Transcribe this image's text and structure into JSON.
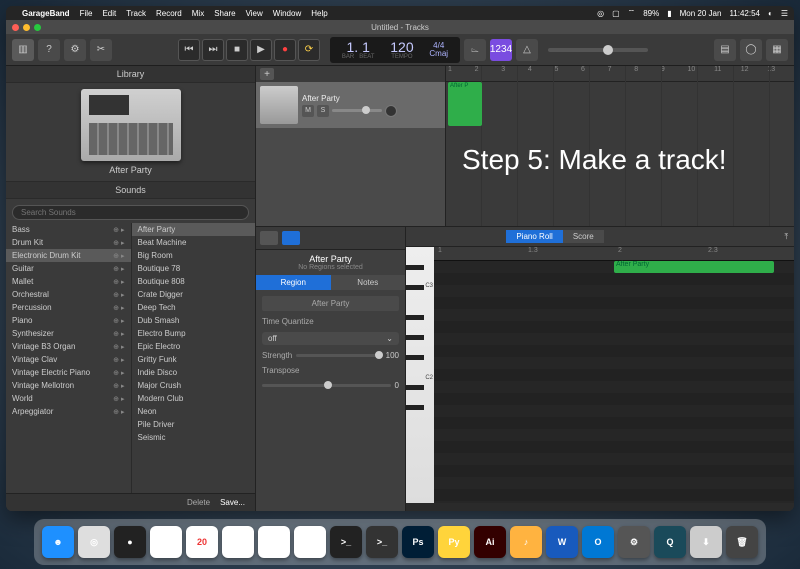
{
  "menubar": {
    "app": "GarageBand",
    "items": [
      "File",
      "Edit",
      "Track",
      "Record",
      "Mix",
      "Share",
      "View",
      "Window",
      "Help"
    ],
    "battery": "89%",
    "date": "Mon 20 Jan",
    "time": "11:42:54"
  },
  "window": {
    "title": "Untitled - Tracks"
  },
  "toolbar": {
    "lcd": {
      "bar_beat": "1. 1",
      "tempo": "120",
      "sig": "4/4",
      "key": "Cmaj",
      "bar_label": "BAR",
      "beat_label": "BEAT",
      "tempo_label": "TEMPO"
    },
    "countin_badge": "1234"
  },
  "library": {
    "header": "Library",
    "device_name": "After Party",
    "sounds_header": "Sounds",
    "search_placeholder": "Search Sounds",
    "categories": [
      "Bass",
      "Drum Kit",
      "Electronic Drum Kit",
      "Guitar",
      "Mallet",
      "Orchestral",
      "Percussion",
      "Piano",
      "Synthesizer",
      "Vintage B3 Organ",
      "Vintage Clav",
      "Vintage Electric Piano",
      "Vintage Mellotron",
      "World",
      "Arpeggiator"
    ],
    "selected_category_index": 2,
    "presets": [
      "After Party",
      "Beat Machine",
      "Big Room",
      "Boutique 78",
      "Boutique 808",
      "Crate Digger",
      "Deep Tech",
      "Dub Smash",
      "Electro Bump",
      "Epic Electro",
      "Gritty Funk",
      "Indie Disco",
      "Major Crush",
      "Modern Club",
      "Neon",
      "Pile Driver",
      "Seismic"
    ],
    "selected_preset_index": 0,
    "delete": "Delete",
    "save": "Save..."
  },
  "tracks": {
    "ruler": [
      "1",
      "2",
      "3",
      "4",
      "5",
      "6",
      "7",
      "8",
      "9",
      "10",
      "11",
      "12",
      "13"
    ],
    "track_name": "After Party",
    "region_name": "After P"
  },
  "overlay": "Step 5: Make a track!",
  "editor": {
    "view_tabs": [
      "Piano Roll",
      "Score"
    ],
    "title": "After Party",
    "subtitle": "No Regions selected",
    "tabs": [
      "Region",
      "Notes"
    ],
    "region_name": "After Party",
    "quantize_label": "Time Quantize",
    "quantize_value": "off",
    "strength_label": "Strength",
    "strength_value": "100",
    "transpose_label": "Transpose",
    "transpose_value": "0",
    "ruler": [
      "1",
      "1.3",
      "2",
      "2.3"
    ],
    "region2_name": "After Party",
    "clabels": [
      "C3",
      "C2"
    ]
  },
  "dock": {
    "items": [
      {
        "name": "finder",
        "bg": "#1e90ff",
        "label": "☻"
      },
      {
        "name": "safari",
        "bg": "#dedede",
        "label": "◎"
      },
      {
        "name": "siri",
        "bg": "#222",
        "label": "●"
      },
      {
        "name": "mail",
        "bg": "#fff",
        "label": "✉"
      },
      {
        "name": "calendar",
        "bg": "#fff",
        "label": "20"
      },
      {
        "name": "chrome",
        "bg": "#fff",
        "label": "◉"
      },
      {
        "name": "apps",
        "bg": "#fff",
        "label": "⊞"
      },
      {
        "name": "photos",
        "bg": "#fff",
        "label": "✿"
      },
      {
        "name": "terminal",
        "bg": "#222",
        "label": ">_"
      },
      {
        "name": "terminal2",
        "bg": "#333",
        "label": ">_"
      },
      {
        "name": "photoshop",
        "bg": "#001e36",
        "label": "Ps"
      },
      {
        "name": "python",
        "bg": "#ffd43b",
        "label": "Py"
      },
      {
        "name": "illustrator",
        "bg": "#330000",
        "label": "Ai"
      },
      {
        "name": "garageband",
        "bg": "#ffb340",
        "label": "♪"
      },
      {
        "name": "word",
        "bg": "#185abd",
        "label": "W"
      },
      {
        "name": "outlook",
        "bg": "#0078d4",
        "label": "O"
      },
      {
        "name": "settings",
        "bg": "#555",
        "label": "⚙"
      },
      {
        "name": "quicktime",
        "bg": "#1a4a5a",
        "label": "Q"
      },
      {
        "name": "downloads",
        "bg": "#ccc",
        "label": "⬇"
      },
      {
        "name": "trash",
        "bg": "#444",
        "label": "🗑"
      }
    ]
  }
}
